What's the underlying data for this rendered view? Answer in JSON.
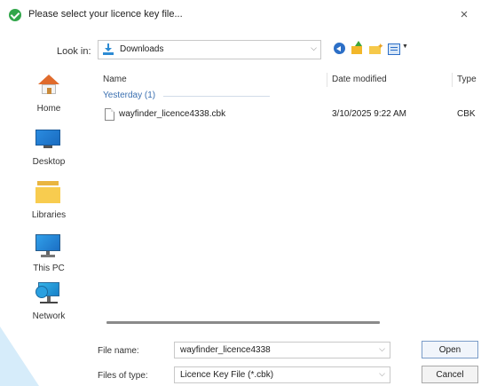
{
  "window": {
    "title": "Please select your licence key file...",
    "close_glyph": "×",
    "title_icon": "check-circle-icon"
  },
  "toolbar": {
    "look_in_label": "Look in:",
    "look_in_value": "Downloads",
    "look_in_icon": "downloads-folder-icon",
    "chevron": "⌵",
    "tools": [
      "back-icon",
      "up-folder-icon",
      "new-folder-icon",
      "view-menu-icon"
    ]
  },
  "places": [
    {
      "label": "Home",
      "icon": "home-icon"
    },
    {
      "label": "Desktop",
      "icon": "desktop-icon"
    },
    {
      "label": "Libraries",
      "icon": "libraries-icon"
    },
    {
      "label": "This PC",
      "icon": "this-pc-icon"
    },
    {
      "label": "Network",
      "icon": "network-icon"
    }
  ],
  "file_list": {
    "columns": [
      "Name",
      "Date modified",
      "Type"
    ],
    "groups": [
      {
        "label": "Yesterday (1)",
        "rows": [
          {
            "name": "wayfinder_licence4338.cbk",
            "date": "3/10/2025 9:22 AM",
            "type": "CBK"
          }
        ]
      }
    ]
  },
  "footer": {
    "file_name_label": "File name:",
    "file_name_value": "wayfinder_licence4338",
    "file_type_label": "Files of type:",
    "file_type_value": "Licence Key File (*.cbk)",
    "open_label": "Open",
    "cancel_label": "Cancel"
  },
  "colors": {
    "accent": "#2c6fc7",
    "group_header": "#3a6fb0",
    "title_icon": "#31a64a"
  }
}
